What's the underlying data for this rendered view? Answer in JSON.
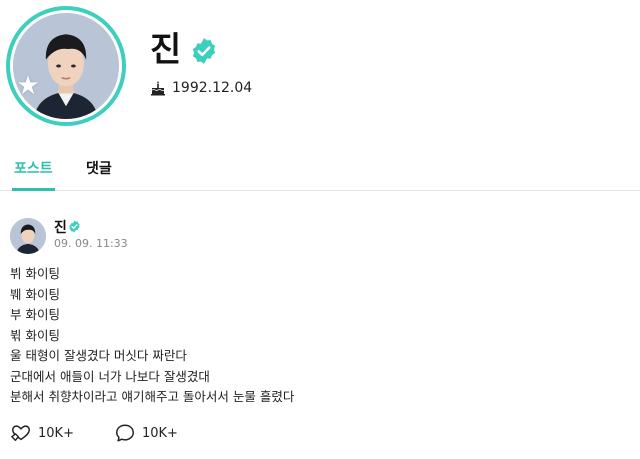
{
  "profile": {
    "name": "진",
    "birthday": "1992.12.04"
  },
  "tabs": [
    {
      "label": "포스트",
      "active": true
    },
    {
      "label": "댓글",
      "active": false
    }
  ],
  "post": {
    "author": "진",
    "timestamp": "09. 09. 11:33",
    "lines": [
      "뷔 화이팅",
      "붸 화이팅",
      "부 화이팅",
      "뷖 화이팅",
      "울 태형이 잘생겼다 머싯다 짜란다",
      "군대에서 애들이 너가 나보다 잘생겼대",
      "분해서 취향차이라고 얘기해주고 돌아서서 눈물 흘렸다"
    ],
    "likes": "10K+",
    "comments": "10K+"
  },
  "colors": {
    "accent": "#2fbfad",
    "verified": "#3ccfbf"
  },
  "icons": {
    "verified": "verified-badge-icon",
    "birthday": "cake-icon",
    "like": "heart-hands-icon",
    "comment": "speech-bubble-icon",
    "avatar_badge": "star-icon"
  }
}
